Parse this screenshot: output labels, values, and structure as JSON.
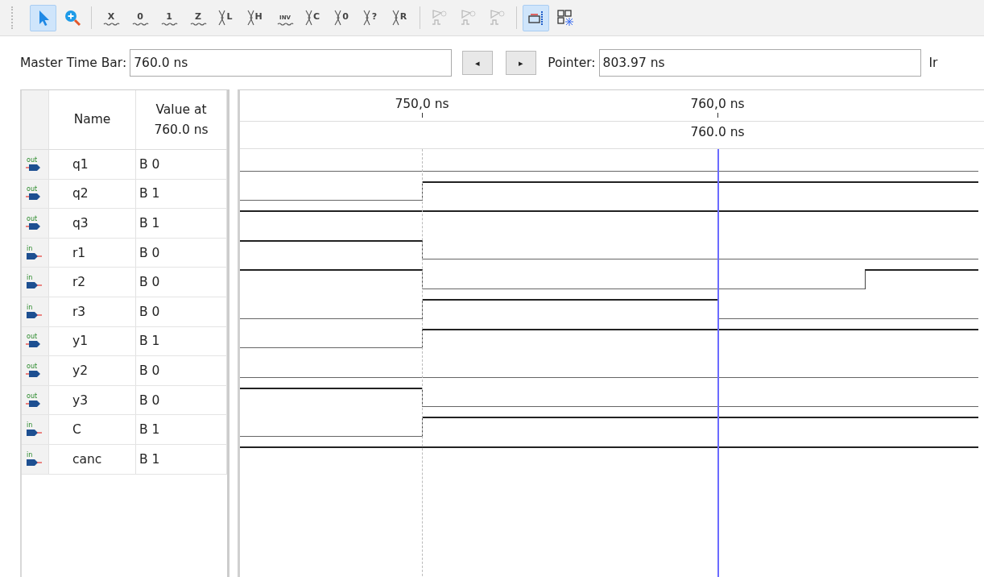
{
  "toolbar": [
    {
      "kind": "pointer",
      "selected": true,
      "disabled": false
    },
    {
      "kind": "zoom",
      "selected": false,
      "disabled": false
    },
    {
      "kind": "separator"
    },
    {
      "kind": "force",
      "glyph": "X",
      "selected": false,
      "disabled": false
    },
    {
      "kind": "force",
      "glyph": "0",
      "selected": false,
      "disabled": false
    },
    {
      "kind": "force",
      "glyph": "1",
      "selected": false,
      "disabled": false
    },
    {
      "kind": "force",
      "glyph": "Z",
      "selected": false,
      "disabled": false
    },
    {
      "kind": "bus",
      "glyph": "L",
      "selected": false,
      "disabled": false
    },
    {
      "kind": "bus",
      "glyph": "H",
      "selected": false,
      "disabled": false
    },
    {
      "kind": "force",
      "glyph": "INV",
      "selected": false,
      "disabled": false
    },
    {
      "kind": "bus",
      "glyph": "C",
      "selected": false,
      "disabled": false
    },
    {
      "kind": "bus",
      "glyph": "0",
      "selected": false,
      "disabled": false
    },
    {
      "kind": "bus",
      "glyph": "?",
      "selected": false,
      "disabled": false
    },
    {
      "kind": "bus",
      "glyph": "R",
      "selected": false,
      "disabled": false
    },
    {
      "kind": "separator"
    },
    {
      "kind": "snap",
      "selected": false,
      "disabled": true
    },
    {
      "kind": "snap",
      "selected": false,
      "disabled": true
    },
    {
      "kind": "snap",
      "selected": false,
      "disabled": true
    },
    {
      "kind": "separator"
    },
    {
      "kind": "transition",
      "selected": true,
      "disabled": false
    },
    {
      "kind": "grid",
      "selected": false,
      "disabled": false
    }
  ],
  "time_bar": {
    "master_label": "Master Time Bar:",
    "master_value": "760.0 ns",
    "prev_button": "◂",
    "next_button": "▸",
    "pointer_label": "Pointer:",
    "pointer_value": "803.97 ns",
    "column_3": "Ir"
  },
  "signals": {
    "columns": [
      "Name",
      "Value at\n760.0 ns"
    ],
    "rows": [
      {
        "kind": "output",
        "pin_label": "out",
        "name": "q1",
        "value": "B 0",
        "wave": [
          {
            "high": false
          },
          {
            "high": false
          },
          {
            "high": false
          },
          {
            "high": false
          }
        ]
      },
      {
        "kind": "output",
        "pin_label": "out",
        "name": "q2",
        "value": "B 1",
        "wave": [
          {
            "high": false
          },
          {
            "high": true
          },
          {
            "high": true
          },
          {
            "high": true
          }
        ]
      },
      {
        "kind": "output",
        "pin_label": "out",
        "name": "q3",
        "value": "B 1",
        "wave": [
          {
            "high": true
          },
          {
            "high": true
          },
          {
            "high": true
          },
          {
            "high": true
          }
        ]
      },
      {
        "kind": "input",
        "pin_label": "in",
        "name": "r1",
        "value": "B 0",
        "wave": [
          {
            "high": true
          },
          {
            "high": false
          },
          {
            "high": false
          },
          {
            "high": false
          }
        ]
      },
      {
        "kind": "input",
        "pin_label": "in",
        "name": "r2",
        "value": "B 0",
        "wave": [
          {
            "high": true
          },
          {
            "high": false
          },
          {
            "high": false
          },
          {
            "high": true
          }
        ]
      },
      {
        "kind": "input",
        "pin_label": "in",
        "name": "r3",
        "value": "B 0",
        "wave": [
          {
            "high": false
          },
          {
            "high": true
          },
          {
            "high": false
          },
          {
            "high": false
          }
        ]
      },
      {
        "kind": "output",
        "pin_label": "out",
        "name": "y1",
        "value": "B 1",
        "wave": [
          {
            "high": false
          },
          {
            "high": true
          },
          {
            "high": true
          },
          {
            "high": true
          }
        ]
      },
      {
        "kind": "output",
        "pin_label": "out",
        "name": "y2",
        "value": "B 0",
        "wave": [
          {
            "high": false
          },
          {
            "high": false
          },
          {
            "high": false
          },
          {
            "high": false
          }
        ]
      },
      {
        "kind": "output",
        "pin_label": "out",
        "name": "y3",
        "value": "B 0",
        "wave": [
          {
            "high": true
          },
          {
            "high": false
          },
          {
            "high": false
          },
          {
            "high": false
          }
        ]
      },
      {
        "kind": "input",
        "pin_label": "in",
        "name": "C",
        "value": "B 1",
        "wave": [
          {
            "high": false
          },
          {
            "high": true
          },
          {
            "high": true
          },
          {
            "high": true
          }
        ]
      },
      {
        "kind": "input",
        "pin_label": "in",
        "name": "canc",
        "value": "B 1",
        "wave": [
          {
            "high": true
          },
          {
            "high": true
          },
          {
            "high": true
          },
          {
            "high": true
          }
        ]
      }
    ]
  },
  "waveform": {
    "ruler": [
      "750,0 ns",
      "760,0 ns"
    ],
    "cursor_label": "760.0 ns"
  }
}
